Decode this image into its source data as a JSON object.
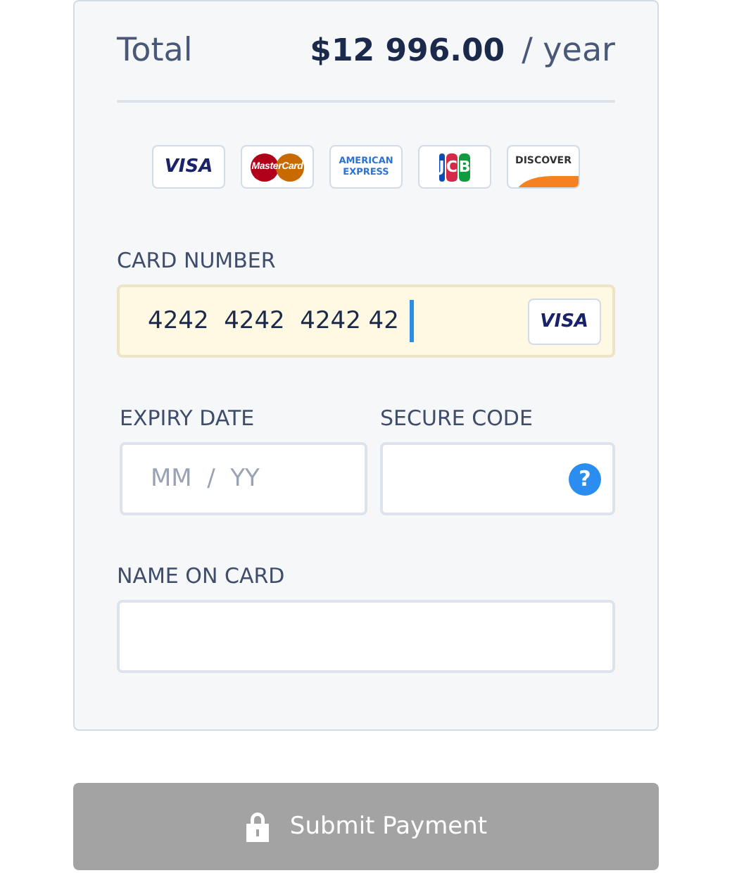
{
  "summary": {
    "label": "Total",
    "amount": "$12 996.00",
    "period": "/ year"
  },
  "brands": [
    {
      "kind": "visa",
      "label": "VISA"
    },
    {
      "kind": "mastercard",
      "label": "MasterCard"
    },
    {
      "kind": "amex",
      "label": "AMERICAN EXPRESS"
    },
    {
      "kind": "jcb",
      "label": "JCB"
    },
    {
      "kind": "discover",
      "label": "DISCOVER"
    }
  ],
  "card_number": {
    "label": "CARD NUMBER",
    "value": "4242  4242  4242 42",
    "focused": true,
    "brand": "VISA"
  },
  "expiry": {
    "label": "EXPIRY DATE",
    "placeholder": "MM  /  YY"
  },
  "secure_code": {
    "label": "SECURE CODE",
    "help": "?"
  },
  "name": {
    "label": "NAME ON CARD"
  },
  "submit": {
    "label": "Submit Payment",
    "disabled": true
  }
}
